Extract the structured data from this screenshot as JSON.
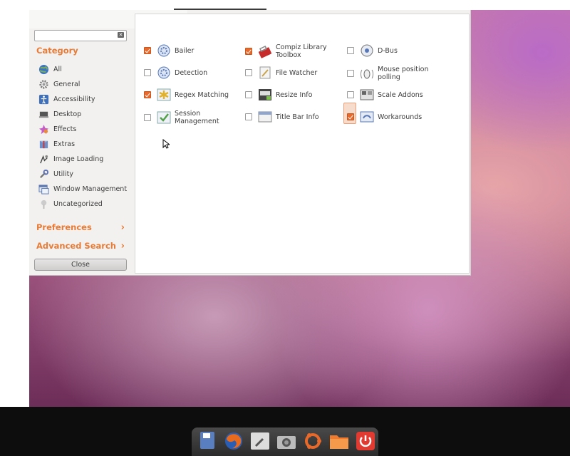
{
  "sidebar": {
    "category_title": "Category",
    "categories": [
      {
        "label": "All",
        "icon": "globe-icon"
      },
      {
        "label": "General",
        "icon": "gear-icon"
      },
      {
        "label": "Accessibility",
        "icon": "accessibility-icon"
      },
      {
        "label": "Desktop",
        "icon": "desktop-icon"
      },
      {
        "label": "Effects",
        "icon": "effects-icon"
      },
      {
        "label": "Extras",
        "icon": "extras-icon"
      },
      {
        "label": "Image Loading",
        "icon": "image-loading-icon"
      },
      {
        "label": "Utility",
        "icon": "utility-icon"
      },
      {
        "label": "Window Management",
        "icon": "window-management-icon"
      },
      {
        "label": "Uncategorized",
        "icon": "uncategorized-icon"
      }
    ],
    "preferences_label": "Preferences",
    "advanced_search_label": "Advanced Search",
    "close_label": "Close",
    "search_placeholder": ""
  },
  "plugins": [
    {
      "label": "Bailer",
      "checked": true
    },
    {
      "label": "Compiz Library Toolbox",
      "checked": true
    },
    {
      "label": "D-Bus",
      "checked": false
    },
    {
      "label": "Detection",
      "checked": false
    },
    {
      "label": "File Watcher",
      "checked": false
    },
    {
      "label": "Mouse position polling",
      "checked": false
    },
    {
      "label": "Regex Matching",
      "checked": true
    },
    {
      "label": "Resize Info",
      "checked": false
    },
    {
      "label": "Scale Addons",
      "checked": false
    },
    {
      "label": "Session Management",
      "checked": false
    },
    {
      "label": "Title Bar Info",
      "checked": false
    },
    {
      "label": "Workarounds",
      "checked": true
    }
  ],
  "dock": [
    "save-icon",
    "firefox-icon",
    "settings-manager-icon",
    "camera-icon",
    "ubuntu-software-icon",
    "folder-icon",
    "power-icon"
  ],
  "colors": {
    "accent": "#e87b35",
    "checkbox_checked": "#e96a2c",
    "panel_bg": "#f2f1f0"
  }
}
